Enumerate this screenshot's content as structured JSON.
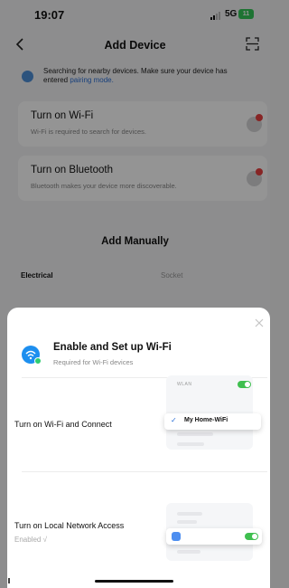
{
  "status_bar": {
    "time": "19:07",
    "network": "5G",
    "battery": "11"
  },
  "nav": {
    "title": "Add Device"
  },
  "hint": {
    "text": "Searching for nearby devices. Make sure your device has entered ",
    "link": "pairing mode."
  },
  "cards": [
    {
      "title": "Turn on Wi-Fi",
      "subtitle": "Wi-Fi is required to search for devices."
    },
    {
      "title": "Turn on Bluetooth",
      "subtitle": "Bluetooth makes your device more discoverable."
    }
  ],
  "add_manually": "Add Manually",
  "category_tabs": [
    "Electrical",
    "Socket"
  ],
  "sheet": {
    "title": "Enable and Set up Wi-Fi",
    "subtitle": "Required for Wi-Fi devices",
    "steps": [
      {
        "label": "Turn on Wi-Fi and Connect"
      },
      {
        "label": "Turn on Local Network Access",
        "status": "Enabled √"
      }
    ],
    "illustration": {
      "header": "WLAN",
      "wifi_name": "My Home-WiFi",
      "check": "✓"
    }
  },
  "colors": {
    "accent": "#1d8fef",
    "toggle_on": "#3fbf4f",
    "link": "#2a6fd6",
    "badge": "#e84141"
  }
}
